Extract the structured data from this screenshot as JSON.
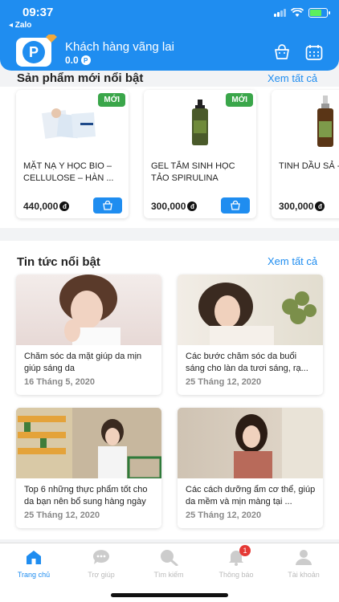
{
  "status": {
    "time": "09:37",
    "back_label": "◂ Zalo"
  },
  "header": {
    "user_name": "Khách hàng vãng lai",
    "points": "0.0",
    "points_symbol": "P"
  },
  "products_section": {
    "title": "Sản phẩm mới nổi bật",
    "see_all": "Xem tất cả",
    "items": [
      {
        "name": "MẶT NẠ Y HỌC BIO – CELLULOSE – HÀN ...",
        "price": "440,000",
        "badge": "MỚI"
      },
      {
        "name": "GEL TẮM SINH HỌC TẢO SPIRULINA",
        "price": "300,000",
        "badge": "MỚI"
      },
      {
        "name": "TINH DẦU SẢ - CHANH",
        "price": "300,000",
        "badge": ""
      }
    ],
    "currency_symbol": "đ"
  },
  "news_section": {
    "title": "Tin tức nổi bật",
    "see_all": "Xem tất cả",
    "items": [
      {
        "title": "Chăm sóc da mặt giúp da mịn giúp sáng da",
        "date": "16 Tháng 5, 2020"
      },
      {
        "title": "Các bước chăm sóc da buổi sáng cho làn da tươi sáng, rạ...",
        "date": "25 Tháng 12, 2020"
      },
      {
        "title": "Top 6 những thực phẩm tốt cho da bạn nên bổ sung hàng ngày",
        "date": "25 Tháng 12, 2020"
      },
      {
        "title": "Các cách dưỡng ẩm cơ thể, giúp da mềm và mịn màng tại ...",
        "date": "25 Tháng 12, 2020"
      }
    ]
  },
  "bottom_nav": {
    "items": [
      {
        "label": "Trang chủ",
        "icon": "home-icon",
        "active": true
      },
      {
        "label": "Trợ giúp",
        "icon": "chat-icon"
      },
      {
        "label": "Tìm kiếm",
        "icon": "search-icon"
      },
      {
        "label": "Thông báo",
        "icon": "bell-icon",
        "badge": "1"
      },
      {
        "label": "Tài khoản",
        "icon": "user-icon"
      }
    ]
  },
  "colors": {
    "primary": "#1f8df0",
    "badge_new": "#3aa64a",
    "notif": "#e53935"
  }
}
